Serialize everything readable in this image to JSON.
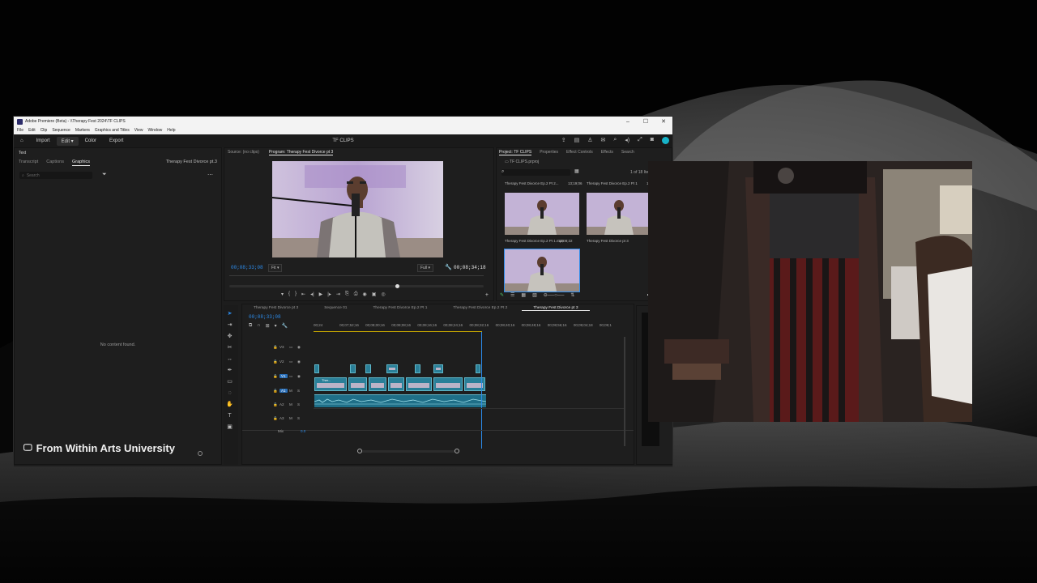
{
  "window": {
    "title": "Adobe Premiere (Beta) - \\\\Therapy Fest 2024\\TF CLIPS",
    "controls": {
      "minimize": "–",
      "maximize": "☐",
      "close": "✕"
    }
  },
  "menu": [
    "File",
    "Edit",
    "Clip",
    "Sequence",
    "Markers",
    "Graphics and Titles",
    "View",
    "Window",
    "Help"
  ],
  "workspaces": {
    "home_icon": "home-icon",
    "items": [
      "Import",
      "Edit",
      "Color",
      "Export"
    ],
    "active": "Edit",
    "project_name": "TF CLIPS"
  },
  "text_panel": {
    "title": "Text",
    "tabs": [
      "Transcript",
      "Captions",
      "Graphics"
    ],
    "active_tab": "Graphics",
    "sequence": "Therapy Fest Divorce pt.3",
    "search_placeholder": "Search",
    "empty_message": "No content found."
  },
  "program_monitor": {
    "tabs": [
      "Source: (no clips)",
      "Program: Therapy Fest Divorce pt 3"
    ],
    "active_tab": "Program: Therapy Fest Divorce pt 3",
    "timecode_current": "00;08;33;08",
    "timecode_duration": "00;08;34;18",
    "fit": "Fit",
    "resolution": "Full",
    "playhead_position": 0.66
  },
  "project_panel": {
    "tabs": [
      "Project: TF CLIPS",
      "Properties",
      "Effect Controls",
      "Effects",
      "Search"
    ],
    "active_tab": "Project: TF CLIPS",
    "folder": "TF CLIPS.prproj",
    "item_count": "1 of 18 Ite",
    "items": [
      {
        "name": "Therapy Fest Divorce Ep.2 Pt 1.mp4",
        "top_label": "Therapy Fest Divorce Ep.2 Pt 2...",
        "duration": "13;19;06"
      },
      {
        "name": "Therapy Fest Divorce pt 3",
        "top_label": "Therapy Fest Divorce Ep.2 Pt 1",
        "duration": "1"
      }
    ],
    "second_duration": "13;08;22"
  },
  "timeline": {
    "tabs": [
      "Therapy Fest Divorce pt 3",
      "Sequence 01",
      "Therapy Fest Divorce Ep.2 Pt 1",
      "Therapy Fest Divorce Ep.2 Pt 2",
      "Therapy Fest Divorce pt 3"
    ],
    "active_tab": 4,
    "timecode": "00;08;33;08",
    "ruler": [
      "00;24",
      "00;07;52;16",
      "00;08;00;16",
      "00;08;08;16",
      "00;08;16;16",
      "00;08;24;16",
      "00;08;32;16",
      "00;08;40;16",
      "00;08;48;16",
      "00;08;56;16",
      "00;09;04;18",
      "00;09;1"
    ],
    "video_tracks": [
      "V3",
      "V2",
      "V1"
    ],
    "audio_tracks": [
      "A1",
      "A2",
      "A3"
    ],
    "mix_label": "Mix",
    "mix_value": "0.0",
    "clip_label": "Ther..."
  },
  "footer": {
    "icon": "monitor-icon",
    "text": "From Within Arts University"
  }
}
